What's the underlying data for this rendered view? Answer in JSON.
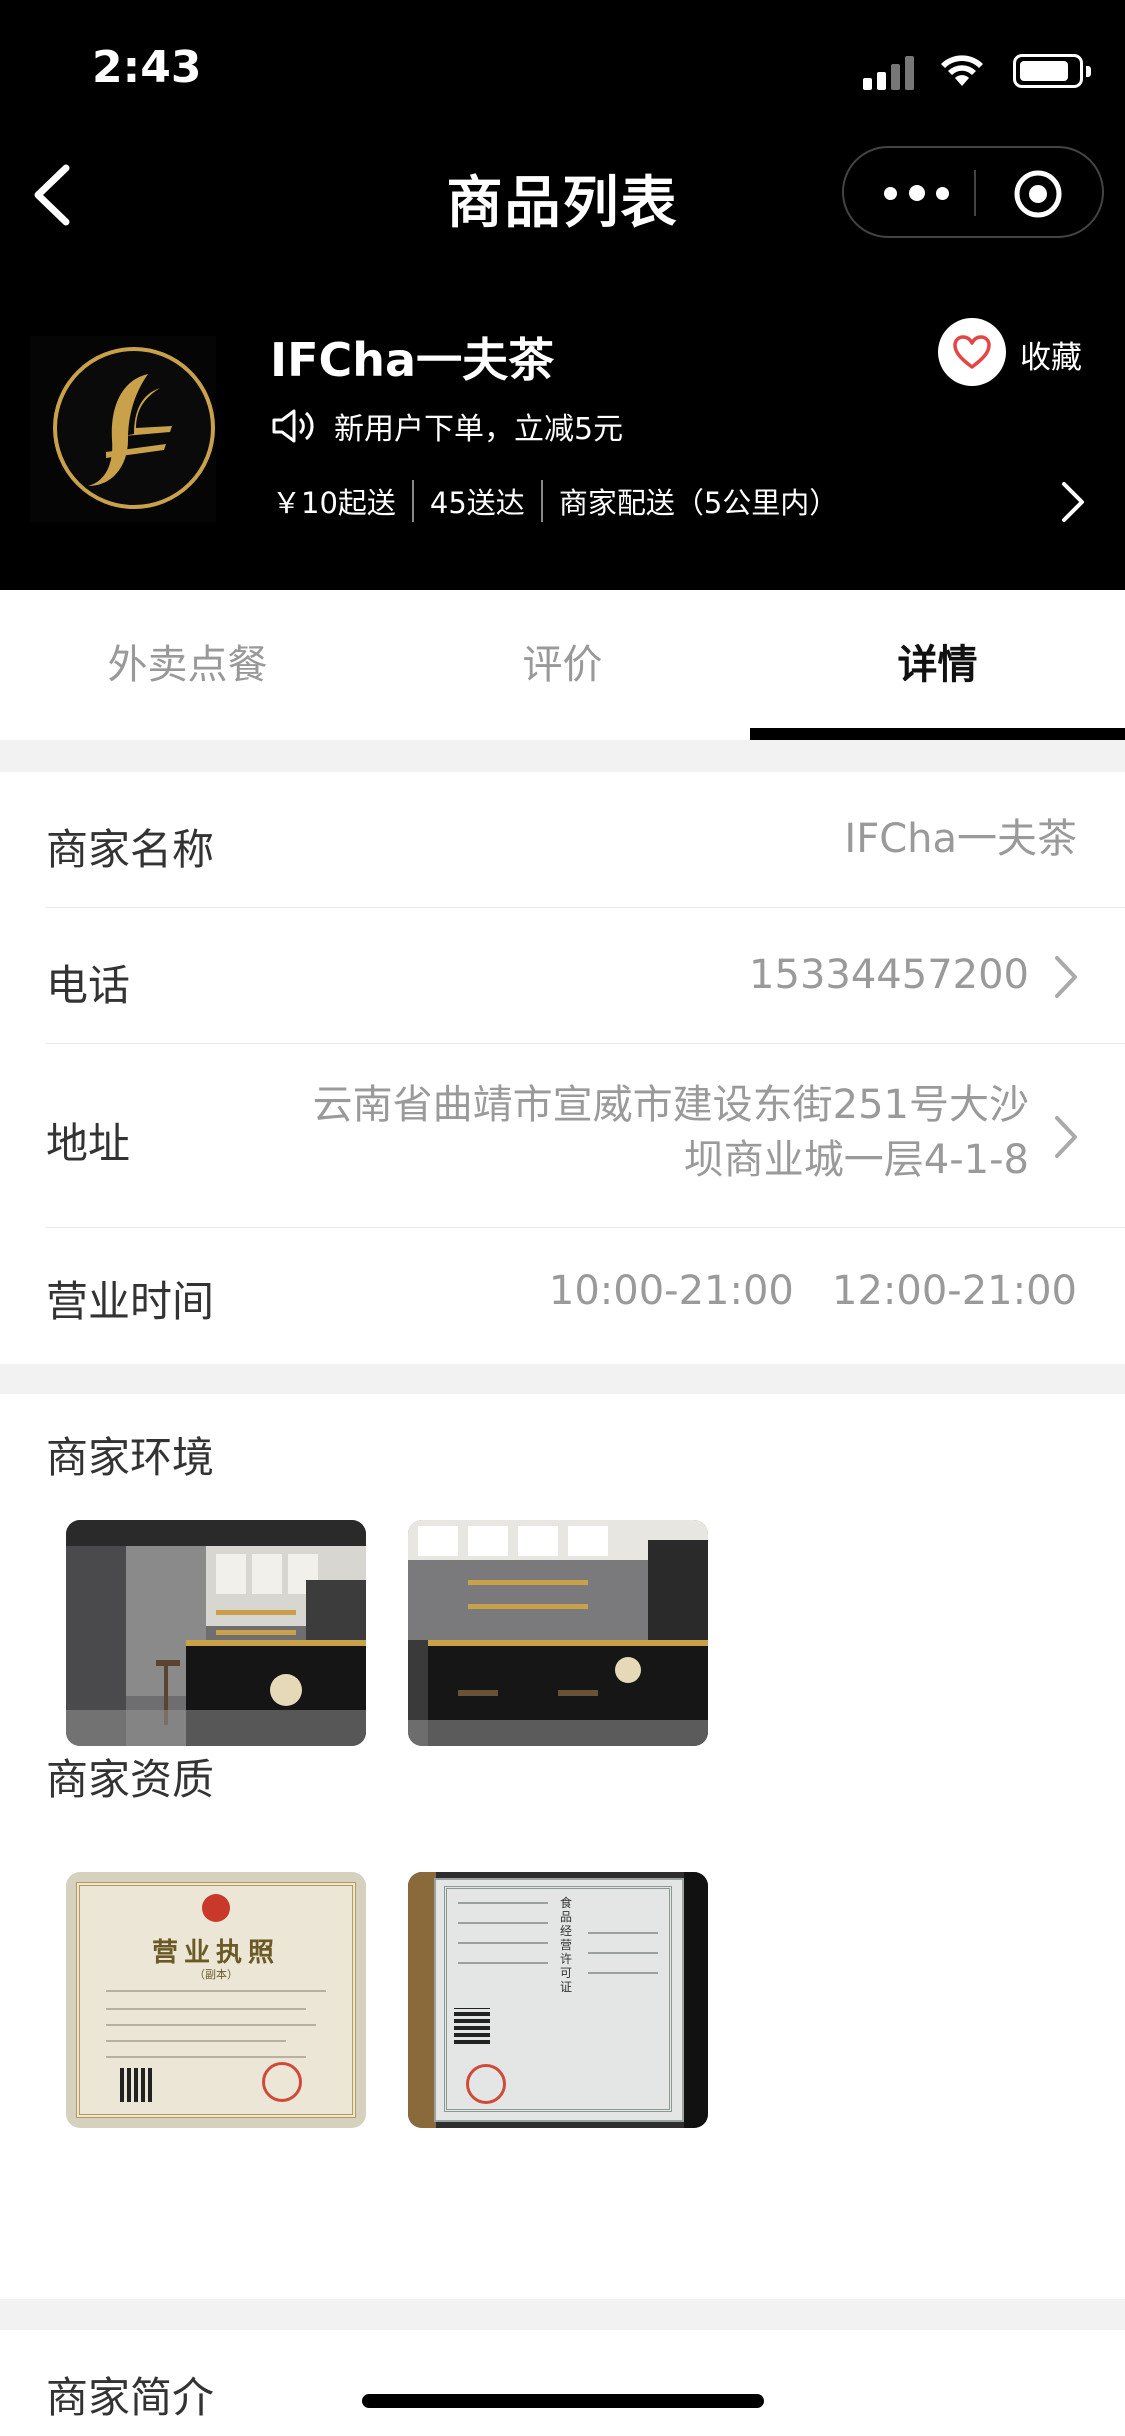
{
  "status_bar": {
    "time": "2:43"
  },
  "nav": {
    "title": "商品列表"
  },
  "shop": {
    "name": "IFCha一夫茶",
    "promo": "新用户下单，立减5元",
    "delivery": [
      "￥10起送",
      "45送达",
      "商家配送（5公里内）"
    ],
    "favorite_label": "收藏"
  },
  "tabs": [
    {
      "label": "外卖点餐",
      "active": false
    },
    {
      "label": "评价",
      "active": false
    },
    {
      "label": "详情",
      "active": true
    }
  ],
  "info": {
    "name": {
      "label": "商家名称",
      "value": "IFCha一夫茶"
    },
    "phone": {
      "label": "电话",
      "value": "15334457200"
    },
    "address": {
      "label": "地址",
      "line1": "云南省曲靖市宣威市建设东街251号大沙",
      "line2": "坝商业城一层4-1-8"
    },
    "hours": {
      "label": "营业时间",
      "value": "10:00-21:00   12:00-21:00"
    }
  },
  "sections": {
    "environment": "商家环境",
    "qualification": "商家资质",
    "intro": "商家简介"
  },
  "certificates": {
    "license_title": "营业执照",
    "license_sub": "（副本）",
    "food_permit_title": "食品经营许可证"
  },
  "colors": {
    "accent_gold": "#c9a14a",
    "header_bg": "#000000",
    "heart": "#e64545"
  }
}
